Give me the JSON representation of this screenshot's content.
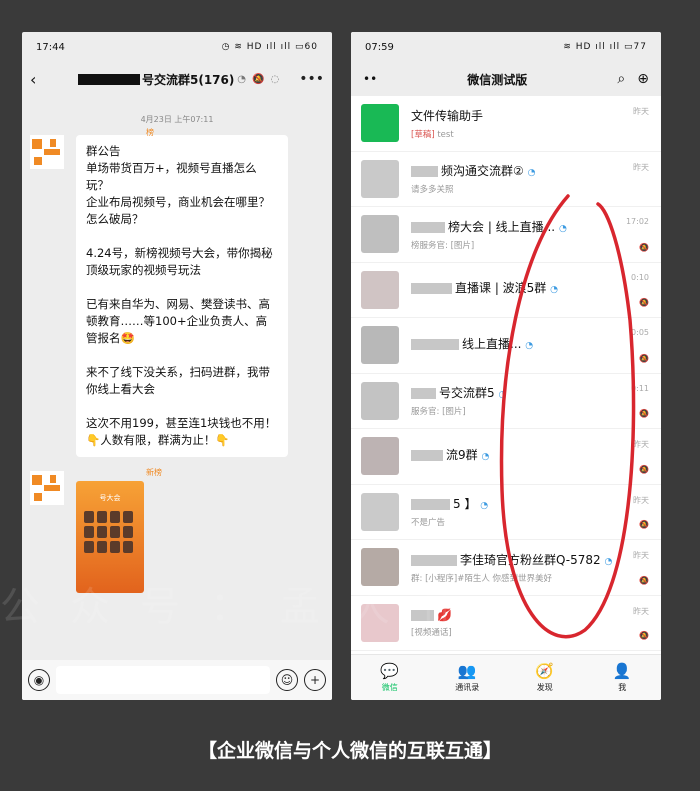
{
  "left_phone": {
    "status_time": "17:44",
    "status_icons": "◷ ≋ HD ıll ıll",
    "battery": "60",
    "chat_title": "号交流群5(176)",
    "timestamp": "4月23日 上午07:11",
    "sender_name_1": "榜",
    "announcement": {
      "heading": "群公告",
      "p1": "单场带货百万+，视频号直播怎么玩？\n企业布局视频号，商业机会在哪里？怎么破局？",
      "p2": "4.24号，新榜视频号大会，带你揭秘顶级玩家的视频号玩法",
      "p3": "已有来自华为、网易、樊登读书、高顿教育……等100+企业负责人、高管报名🤩",
      "p4": "来不了线下没关系，扫码进群，我带你线上看大会",
      "p5": "这次不用199，甚至连1块钱也不用！\n👇人数有限，群满为止！👇"
    },
    "sender_name_2": "新榜",
    "poster_title": "号大会"
  },
  "right_phone": {
    "status_time": "07:59",
    "status_icons": "≋ HD ıll ıll",
    "battery": "77",
    "more_label": "••",
    "app_title": "微信测试版",
    "conversations": [
      {
        "name": "文件传输助手",
        "draft": "[草稿]",
        "preview": " test",
        "time": "昨天",
        "avatar_color": "#19b955"
      },
      {
        "name": "频沟通交流群②",
        "draft": "",
        "preview": "请多多关照",
        "time": "昨天",
        "avatar_color": "#c9c9c9"
      },
      {
        "name": "榜大会 | 线上直播...",
        "draft": "",
        "preview": "榜服务官: [图片]",
        "time": "17:02",
        "avatar_color": "#bfbfbf"
      },
      {
        "name": "直播课 | 波浪5群",
        "draft": "",
        "preview": "",
        "time": "0:10",
        "avatar_color": "#d0c4c4"
      },
      {
        "name": "线上直播...",
        "draft": "",
        "preview": "",
        "time": "0:05",
        "avatar_color": "#b8b8b8"
      },
      {
        "name": "号交流群5",
        "draft": "",
        "preview": "服务官: [图片]",
        "time": "0:11",
        "avatar_color": "#c3c3c3"
      },
      {
        "name": "流9群",
        "draft": "",
        "preview": "",
        "time": "昨天",
        "avatar_color": "#bdb3b3"
      },
      {
        "name": "5 】",
        "draft": "",
        "preview": "不是广告",
        "time": "昨天",
        "avatar_color": "#cacaca"
      },
      {
        "name": "李佳琦官方粉丝群Q-5782",
        "draft": "",
        "preview": "群: [小程序]#陌生人 你感到世界美好",
        "time": "昨天",
        "avatar_color": "#b5aaa5"
      },
      {
        "name": "💋",
        "draft": "",
        "preview": "[视频通话]",
        "time": "昨天",
        "avatar_color": "#e8c8cc"
      }
    ],
    "tabs": [
      {
        "label": "微信",
        "icon": "💬"
      },
      {
        "label": "通讯录",
        "icon": "👥"
      },
      {
        "label": "发现",
        "icon": "🧭"
      },
      {
        "label": "我",
        "icon": "👤"
      }
    ]
  },
  "watermark": "公众号：孟大伟",
  "caption": "【企业微信与个人微信的互联互通】",
  "colors": {
    "accent": "#07c160",
    "brand_orange": "#f08a24",
    "loop": "#d8262e"
  }
}
